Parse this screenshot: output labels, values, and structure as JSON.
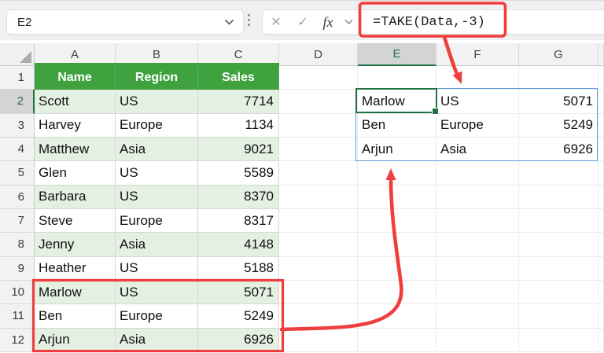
{
  "app": {
    "name_box_value": "E2",
    "cancel_label": "✕",
    "enter_label": "✓",
    "fx_label": "fx",
    "formula": "=TAKE(Data,-3)"
  },
  "grid": {
    "column_letters": [
      "A",
      "B",
      "C",
      "D",
      "E",
      "F",
      "G"
    ],
    "row_numbers": [
      1,
      2,
      3,
      4,
      5,
      6,
      7,
      8,
      9,
      10,
      11,
      12
    ],
    "selected_column": "E",
    "selected_row": 2,
    "active_cell": "E2"
  },
  "table": {
    "headers": [
      "Name",
      "Region",
      "Sales"
    ],
    "rows": [
      {
        "name": "Scott",
        "region": "US",
        "sales": "7714"
      },
      {
        "name": "Harvey",
        "region": "Europe",
        "sales": "1134"
      },
      {
        "name": "Matthew",
        "region": "Asia",
        "sales": "9021"
      },
      {
        "name": "Glen",
        "region": "US",
        "sales": "5589"
      },
      {
        "name": "Barbara",
        "region": "US",
        "sales": "8370"
      },
      {
        "name": "Steve",
        "region": "Europe",
        "sales": "8317"
      },
      {
        "name": "Jenny",
        "region": "Asia",
        "sales": "4148"
      },
      {
        "name": "Heather",
        "region": "US",
        "sales": "5188"
      },
      {
        "name": "Marlow",
        "region": "US",
        "sales": "5071"
      },
      {
        "name": "Ben",
        "region": "Europe",
        "sales": "5249"
      },
      {
        "name": "Arjun",
        "region": "Asia",
        "sales": "6926"
      }
    ]
  },
  "spill_result": {
    "anchor_cell": "E2",
    "rows": [
      {
        "name": "Marlow",
        "region": "US",
        "sales": "5071"
      },
      {
        "name": "Ben",
        "region": "Europe",
        "sales": "5249"
      },
      {
        "name": "Arjun",
        "region": "Asia",
        "sales": "6926"
      }
    ]
  },
  "annotations": {
    "formula_highlight": "red box around formula =TAKE(Data,-3)",
    "source_highlight": "red box around last 3 table rows A10:C12",
    "arrow_formula_to_result": "red arrow from formula bar to spilled range",
    "arrow_source_to_result": "red arrow from highlighted rows to spilled range"
  },
  "colors": {
    "table_header_green": "#3FA23F",
    "banded_row_green": "#E4F1E2",
    "selection_green": "#217346",
    "spill_border_blue": "#5B9BD5",
    "annotation_red": "#EF3E3E",
    "header_gray": "#F3F2F2",
    "selected_header_gray": "#D5D4D4"
  }
}
